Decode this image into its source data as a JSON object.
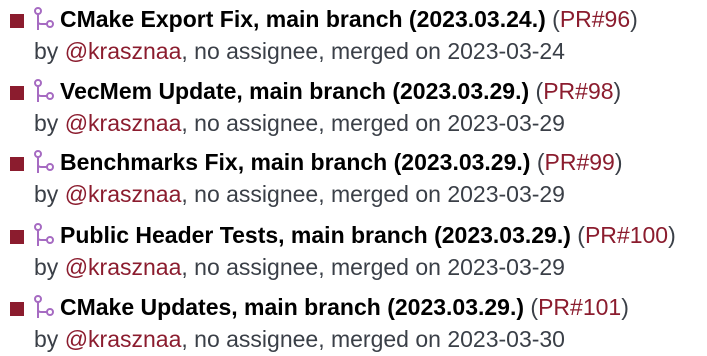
{
  "colors": {
    "accent": "#8b1c2e",
    "text": "#3a3f47",
    "title": "#000000",
    "icon": "#a66bc2"
  },
  "icon_name": "git-pull-request-icon",
  "items": [
    {
      "title": "CMake Export Fix, main branch (2023.03.24.)",
      "pr_label": "PR#96",
      "by_prefix": "by ",
      "author": "@krasznaa",
      "details": ", no assignee, merged on 2023-03-24"
    },
    {
      "title": "VecMem Update, main branch (2023.03.29.)",
      "pr_label": "PR#98",
      "by_prefix": "by ",
      "author": "@krasznaa",
      "details": ", no assignee, merged on 2023-03-29"
    },
    {
      "title": "Benchmarks Fix, main branch (2023.03.29.)",
      "pr_label": "PR#99",
      "by_prefix": "by ",
      "author": "@krasznaa",
      "details": ", no assignee, merged on 2023-03-29"
    },
    {
      "title": "Public Header Tests, main branch (2023.03.29.)",
      "pr_label": "PR#100",
      "by_prefix": "by ",
      "author": "@krasznaa",
      "details": ", no assignee, merged on 2023-03-29"
    },
    {
      "title": "CMake Updates, main branch (2023.03.29.)",
      "pr_label": "PR#101",
      "by_prefix": "by ",
      "author": "@krasznaa",
      "details": ", no assignee, merged on 2023-03-30"
    }
  ]
}
